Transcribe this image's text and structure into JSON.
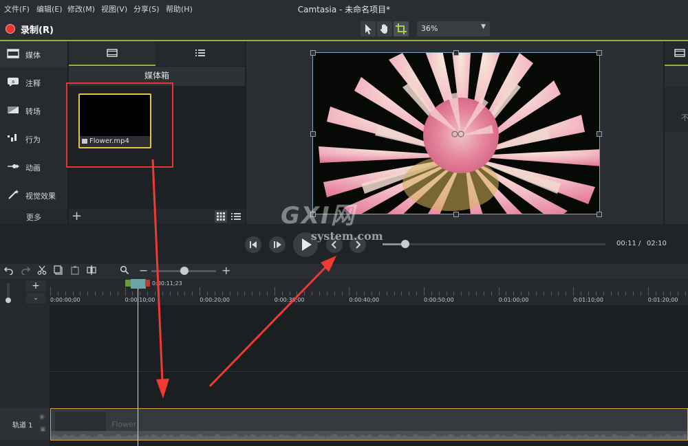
{
  "menubar": {
    "items": [
      "文件(F)",
      "编辑(E)",
      "修改(M)",
      "视图(V)",
      "分享(S)",
      "帮助(H)"
    ],
    "title": "Camtasia - 未命名项目*"
  },
  "toolbar": {
    "record_label": "录制(R)",
    "zoom_value": "36%"
  },
  "sidebar": {
    "items": [
      {
        "label": "媒体",
        "icon": "film-icon"
      },
      {
        "label": "注释",
        "icon": "annotation-icon"
      },
      {
        "label": "转场",
        "icon": "transition-icon"
      },
      {
        "label": "行为",
        "icon": "behavior-icon"
      },
      {
        "label": "动画",
        "icon": "animation-icon"
      },
      {
        "label": "视觉效果",
        "icon": "visual-effects-icon"
      }
    ],
    "more_label": "更多"
  },
  "bin": {
    "title": "媒体箱",
    "thumb_label": "Flower.mp4",
    "add_label": "+"
  },
  "right_panel": {
    "text": "不"
  },
  "playback": {
    "current_time": "00:11",
    "separator": "/",
    "total_time": "02:10",
    "progress": 0.085
  },
  "timeline": {
    "playhead_time": "0:00:11;23",
    "ticks": [
      "0:00:00;00",
      "0:00:10;00",
      "0:00:20;00",
      "0:00:30;00",
      "0:00:40;00",
      "0:00:50;00",
      "0:01:00;00",
      "0:01:10;00",
      "0:01:20;00"
    ],
    "zoom_level": 0.5
  },
  "tracks": {
    "track1_label": "轨道 1",
    "clip_label": "Flower"
  },
  "watermark": {
    "line1": "GXI网",
    "line2": "system.com"
  },
  "colors": {
    "accent": "#8fb53b",
    "record": "#e8352f",
    "selection": "#e8c34a",
    "annotation": "#f03a33"
  }
}
